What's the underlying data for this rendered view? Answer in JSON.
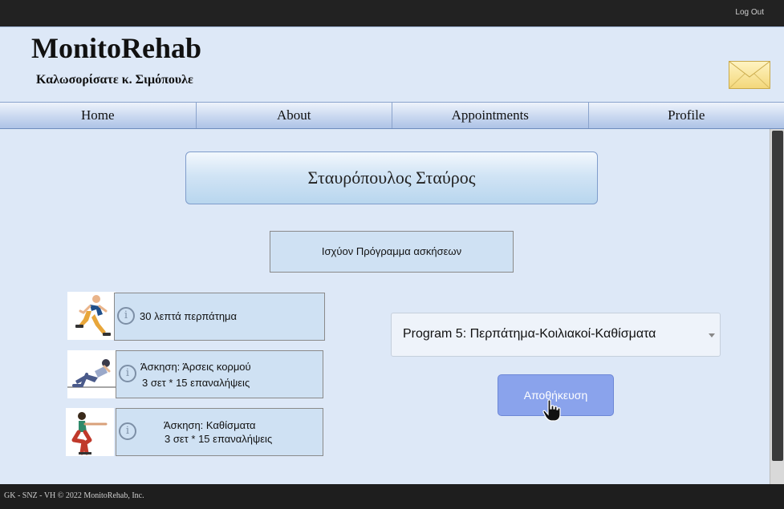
{
  "topbar": {
    "logout_label": "Log Out"
  },
  "header": {
    "brand": "MonitoRehab",
    "welcome": "Καλωσορίσατε κ. Σιμόπουλε"
  },
  "nav": [
    {
      "label": "Home"
    },
    {
      "label": "About"
    },
    {
      "label": "Appointments"
    },
    {
      "label": "Profile"
    }
  ],
  "patient": {
    "name": "Σταυρόπουλος Σταύρος"
  },
  "program": {
    "current_label": "Ισχύον Πρόγραμμα ασκήσεων",
    "exercises": [
      {
        "icon": "running-person-icon",
        "lines": [
          "30 λεπτά περπάτημα"
        ]
      },
      {
        "icon": "situps-person-icon",
        "lines": [
          "Άσκηση: Άρσεις κορμού",
          "3 σετ * 15 επαναλήψεις"
        ]
      },
      {
        "icon": "squat-person-icon",
        "lines": [
          "Άσκηση: Καθίσματα",
          "3 σετ * 15 επαναλήψεις"
        ]
      }
    ],
    "selected_program": "Program 5: Περπάτημα-Κοιλιακοί-Καθίσματα",
    "save_label": "Αποθήκευση"
  },
  "footer": {
    "text": "GK - SNZ - VH © 2022 MonitoRehab, Inc."
  },
  "colors": {
    "background": "#dde8f7",
    "topbar": "#222222",
    "save_button": "#8aa3ec",
    "card": "#cfe1f3"
  }
}
